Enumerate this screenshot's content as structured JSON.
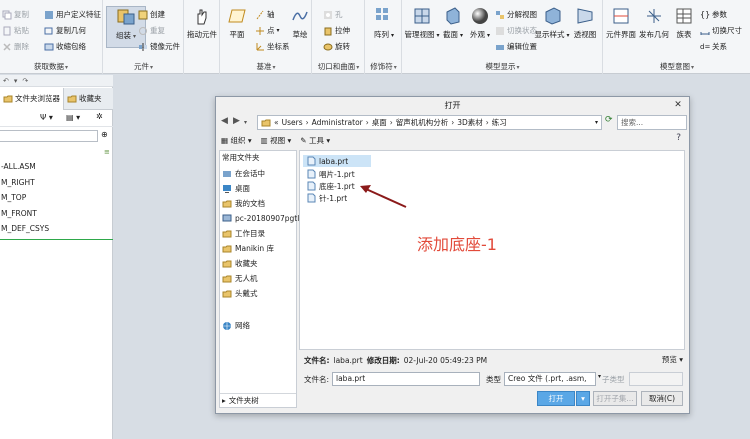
{
  "ribbon": {
    "groups": [
      {
        "label": "获取数据",
        "buttons": [
          "复制",
          "粘贴",
          "删除",
          "用户定义特征",
          "复制几何",
          "收缩包络"
        ]
      },
      {
        "label": "元件",
        "buttons": [
          "组装",
          "创建",
          "重复",
          "镜像元件"
        ]
      },
      {
        "label": "",
        "buttons": [
          "拖动元件"
        ]
      },
      {
        "label": "基准",
        "buttons": [
          "平面",
          "轴",
          "点",
          "坐标系",
          "草绘"
        ]
      },
      {
        "label": "切口和曲面",
        "buttons": [
          "孔",
          "拉伸",
          "旋转"
        ]
      },
      {
        "label": "修饰符",
        "buttons": [
          "阵列"
        ]
      },
      {
        "label": "模型显示",
        "buttons": [
          "管理视图",
          "截面",
          "外观",
          "分解视图",
          "切换状态",
          "编辑位置",
          "显示样式",
          "透视图"
        ]
      },
      {
        "label": "模型意图",
        "buttons": [
          "元件界面",
          "发布几何",
          "族表",
          "参数",
          "切换尺寸",
          "关系"
        ]
      }
    ]
  },
  "left_panel": {
    "tabs": [
      "文件夹浏览器",
      "收藏夹"
    ],
    "tree": [
      "-ALL.ASM",
      "M_RIGHT",
      "M_TOP",
      "M_FRONT",
      "M_DEF_CSYS"
    ]
  },
  "dialog": {
    "title": "打开",
    "path": [
      "Users",
      "Administrator",
      "桌面",
      "留声机机构分析",
      "3D素材",
      "练习"
    ],
    "search_placeholder": "搜索...",
    "toolbar": [
      "组织",
      "视图",
      "工具"
    ],
    "sidebar": {
      "header": "常用文件夹",
      "items": [
        "在会话中",
        "桌面",
        "我的文档",
        "pc-20180907pgtl",
        "工作目录",
        "Manikin 库",
        "收藏夹",
        "无人机",
        "头戴式",
        "网络"
      ],
      "footer": "文件夹树"
    },
    "files": [
      "laba.prt",
      "唱片-1.prt",
      "底座-1.prt",
      "针-1.prt"
    ],
    "selected_file": "laba.prt",
    "details": {
      "name_label": "文件名:",
      "name_value": "laba.prt",
      "date_label": "修改日期:",
      "date_value": "02-Jul-20 05:49:23 PM",
      "preview": "预览"
    },
    "name_row": {
      "label": "文件名:",
      "value": "laba.prt",
      "type_label": "类型",
      "type_value": "Creo 文件 (.prt, .asm,",
      "subtype_label": "子类型"
    },
    "buttons": {
      "open": "打开",
      "open_sub": "打开子集...",
      "cancel": "取消(C)"
    }
  },
  "annotation": "添加底座-1",
  "colors": {
    "accent": "#3b86c6",
    "annotation": "#e24a3a",
    "arrow": "#8b1a1a"
  }
}
